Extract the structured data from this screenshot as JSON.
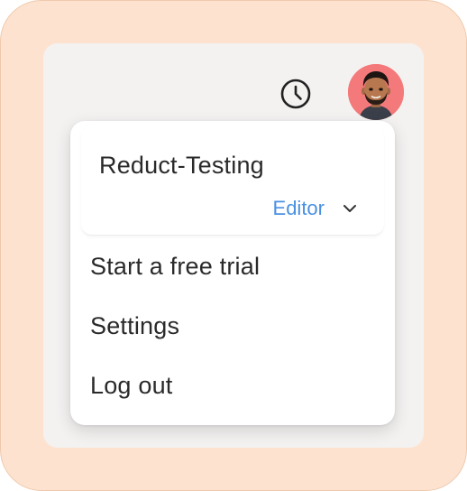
{
  "header": {
    "history_icon": "clock-icon",
    "avatar_icon": "user-avatar"
  },
  "menu": {
    "workspace": {
      "name": "Reduct-Testing",
      "role": "Editor",
      "role_icon": "chevron-down-icon"
    },
    "items": [
      {
        "label": "Start a free trial"
      },
      {
        "label": "Settings"
      },
      {
        "label": "Log out"
      }
    ]
  },
  "colors": {
    "frame_bg": "#fde3cf",
    "panel_bg": "#f4f2f1",
    "avatar_bg": "#f4797a",
    "role_accent": "#4a90e2",
    "text": "#2a2a2a"
  }
}
